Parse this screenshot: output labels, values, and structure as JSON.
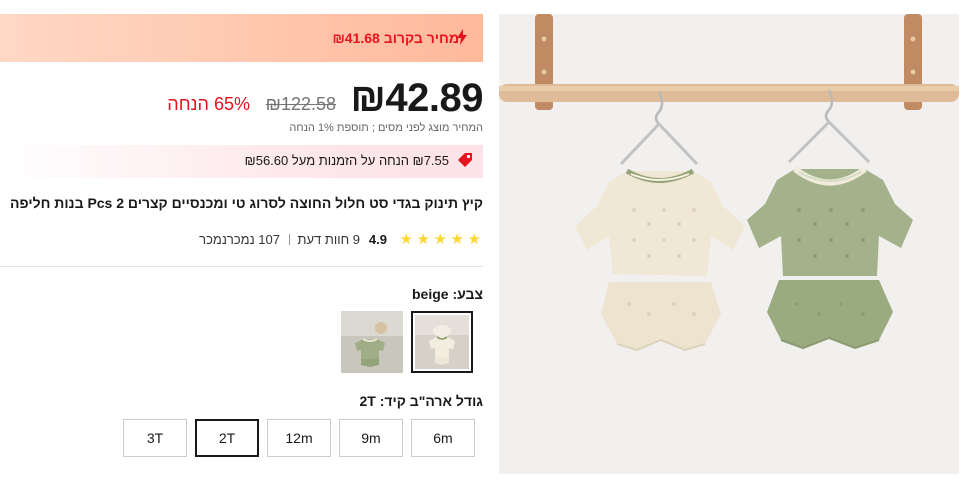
{
  "banner": {
    "text": "מחיר בקרוב ₪41.68",
    "icon": "lightning-icon",
    "color": "#e8121c"
  },
  "price": {
    "current": "₪42.89",
    "original": "₪122.58",
    "discount": "65% הנחה",
    "tax_note": "המחיר מוצג לפני מסים ; תוספת 1% הנחה"
  },
  "coupon": {
    "text": "₪7.55 הנחה על הזמנות מעל ₪56.60",
    "icon": "coupon-tag-icon"
  },
  "product": {
    "title": "קיץ תינוק בגדי סט חלול החוצה לסרוג טי ומכנסיים קצרים Pcs 2 בנות חליפה"
  },
  "rating": {
    "score": "4.9",
    "stars": 5,
    "reviews": "9 חוות דעת",
    "sold": "107 נמכרנמכר"
  },
  "color": {
    "label": "צבע:",
    "value": "beige",
    "options": [
      "beige",
      "green"
    ]
  },
  "size": {
    "label": "גודל ארה\"ב קיד:",
    "value": "2T",
    "options": [
      "6m",
      "9m",
      "12m",
      "2T",
      "3T"
    ]
  }
}
